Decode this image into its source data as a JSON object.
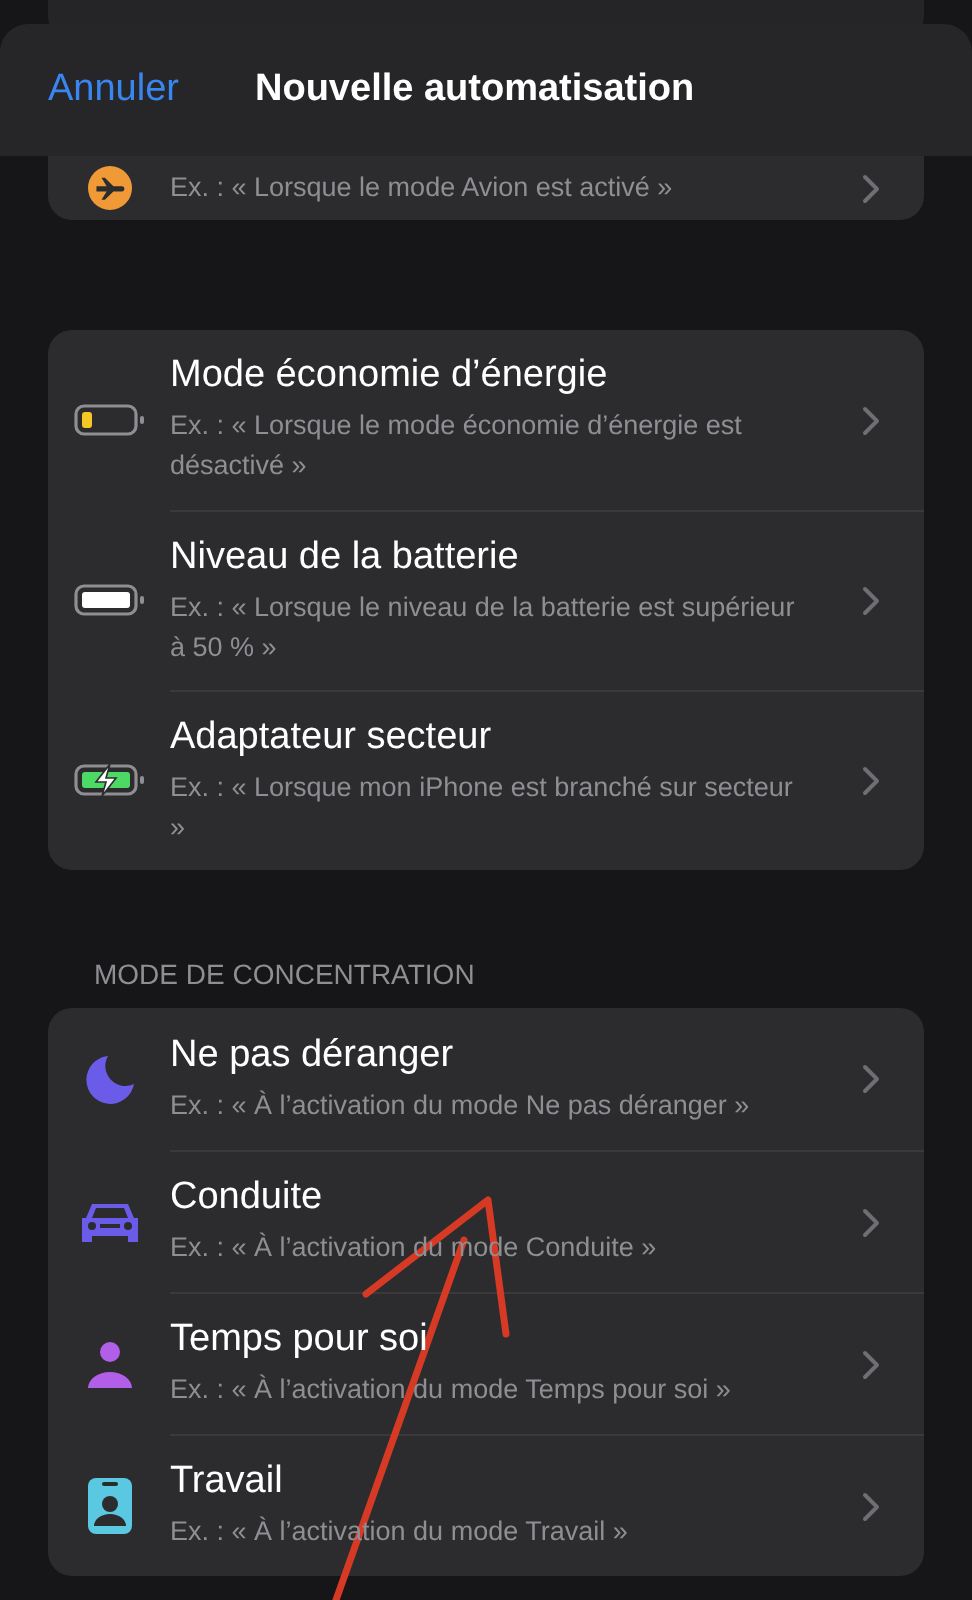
{
  "header": {
    "cancel": "Annuler",
    "title": "Nouvelle automatisation"
  },
  "sections": [
    {
      "rows": [
        {
          "subtitle": "Ex. : « Lorsque le mode Avion est activé »"
        }
      ]
    },
    {
      "rows": [
        {
          "title": "Mode économie d’énergie",
          "subtitle": "Ex. : « Lorsque le mode économie d’énergie est désactivé »"
        },
        {
          "title": "Niveau de la batterie",
          "subtitle": "Ex. : « Lorsque le niveau de la batterie est supérieur à 50 % »"
        },
        {
          "title": "Adaptateur secteur",
          "subtitle": "Ex. : « Lorsque mon iPhone est branché sur secteur »"
        }
      ]
    },
    {
      "heading": "MODE DE CONCENTRATION",
      "rows": [
        {
          "title": "Ne pas déranger",
          "subtitle": "Ex. : « À l’activation du mode Ne pas déranger »"
        },
        {
          "title": "Conduite",
          "subtitle": "Ex. : « À l’activation du mode Conduite »"
        },
        {
          "title": "Temps pour soi",
          "subtitle": "Ex. : « À l’activation du mode Temps pour soi »"
        },
        {
          "title": "Travail",
          "subtitle": "Ex. : « À l’activation du mode Travail »"
        }
      ]
    }
  ]
}
